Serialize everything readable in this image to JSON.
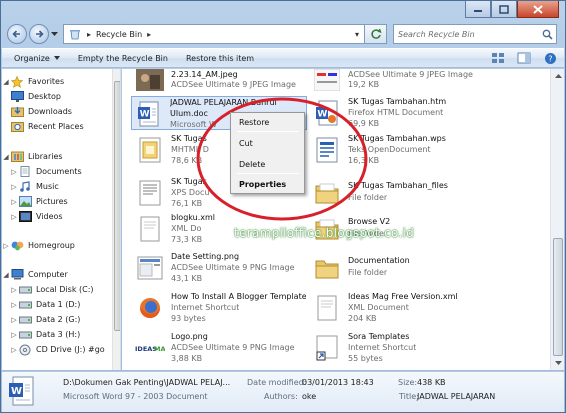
{
  "window": {
    "address": {
      "path_label": "Recycle Bin"
    },
    "search": {
      "placeholder": "Search Recycle Bin"
    }
  },
  "toolbar": {
    "organize": "Organize",
    "empty": "Empty the Recycle Bin",
    "restore_all": "Restore this item"
  },
  "nav": {
    "favorites": "Favorites",
    "desktop": "Desktop",
    "downloads": "Downloads",
    "recent": "Recent Places",
    "libraries": "Libraries",
    "documents": "Documents",
    "music": "Music",
    "pictures": "Pictures",
    "videos": "Videos",
    "homegroup": "Homegroup",
    "computer": "Computer",
    "local_disk": "Local Disk (C:)",
    "data1": "Data 1 (D:)",
    "data2": "Data 2 (G:)",
    "data3": "Data 3 (H:)",
    "cd": "CD Drive (J:) #go"
  },
  "files": [
    {
      "name": "2.23.14_AM.jpeg",
      "type": "ACDSee Ultimate 9 JPEG Image",
      "size": ""
    },
    {
      "name": "",
      "type": "ACDSee Ultimate 9 JPEG Image",
      "size": "19,2 KB"
    },
    {
      "name": "JADWAL PELAJARAN Bahrul",
      "name2": "Ulum.doc",
      "type": "Microsoft W"
    },
    {
      "name": "SK Tugas Tambahan.htm",
      "type": "Firefox HTML Document",
      "size": "69,9 KB"
    },
    {
      "name": "SK Tugas",
      "type": "MHTML D",
      "size": "78,6 KB"
    },
    {
      "name": "SK Tugas Tambahan.wps",
      "type": "Teks OpenDocument",
      "size": "16,3 KB"
    },
    {
      "name": "SK Tugas",
      "type": "XPS Docu",
      "size": "76,1 KB"
    },
    {
      "name": "SK Tugas Tambahan_files",
      "type": "File folder",
      "size": ""
    },
    {
      "name": "blogku.xml",
      "type": "XML Do",
      "size": "73,3 KB"
    },
    {
      "name": "Browse V2",
      "type": "File folder",
      "size": ""
    },
    {
      "name": "Date Setting.png",
      "type": "ACDSee Ultimate 9 PNG Image",
      "size": "43,1 KB"
    },
    {
      "name": "Documentation",
      "type": "File folder",
      "size": ""
    },
    {
      "name": "How To Install A Blogger Template",
      "type": "Internet Shortcut",
      "size": "93 bytes"
    },
    {
      "name": "Ideas Mag Free Version.xml",
      "type": "XML Document",
      "size": "204 KB"
    },
    {
      "name": "Logo.png",
      "type": "ACDSee Ultimate 9 PNG Image",
      "size": "3,88 KB"
    },
    {
      "name": "Sora Templates",
      "type": "Internet Shortcut",
      "size": "55 bytes"
    }
  ],
  "context_menu": {
    "restore": "Restore",
    "cut": "Cut",
    "delete": "Delete",
    "properties": "Properties"
  },
  "watermark": "terampiloffice.blogspot.co.id",
  "details": {
    "path": "D:\\Dokumen Gak Penting\\JADWAL PELAJ...",
    "type": "Microsoft Word 97 - 2003 Document",
    "date_label": "Date modified:",
    "date_value": "03/01/2013 18:43",
    "authors_label": "Authors:",
    "authors_value": "oke",
    "size_label": "Size:",
    "size_value": "438 KB",
    "title_label": "Title:",
    "title_value": "JADWAL PELAJARAN"
  },
  "colors": {
    "highlight_circle": "#d8202a",
    "selection": "#dde9f8",
    "watermark_glow": "#1e7d1e"
  }
}
